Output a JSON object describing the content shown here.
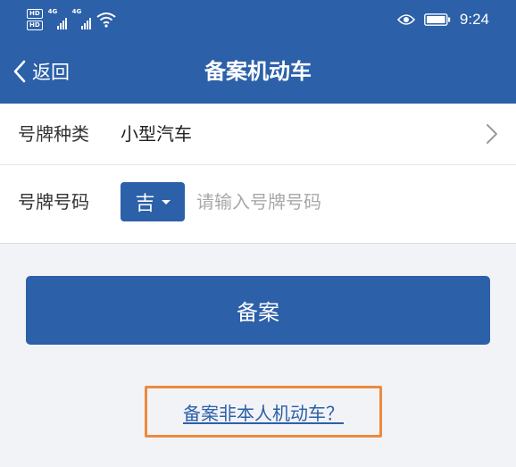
{
  "status_bar": {
    "hd_badge": "HD",
    "network": "4G",
    "time": "9:24"
  },
  "nav": {
    "back_label": "返回",
    "title": "备案机动车"
  },
  "form": {
    "plate_type": {
      "label": "号牌种类",
      "value": "小型汽车"
    },
    "plate_number": {
      "label": "号牌号码",
      "province": "吉",
      "placeholder": "请输入号牌号码"
    }
  },
  "submit_button": "备案",
  "other_vehicle_link": "备案非本人机动车？",
  "colors": {
    "primary": "#2c60a8",
    "highlight": "#ec8a3c",
    "background": "#f2f3f7"
  },
  "icons": [
    "wifi-icon",
    "eye-icon",
    "battery-icon",
    "chevron-left-icon",
    "chevron-right-icon",
    "caret-down-icon"
  ]
}
